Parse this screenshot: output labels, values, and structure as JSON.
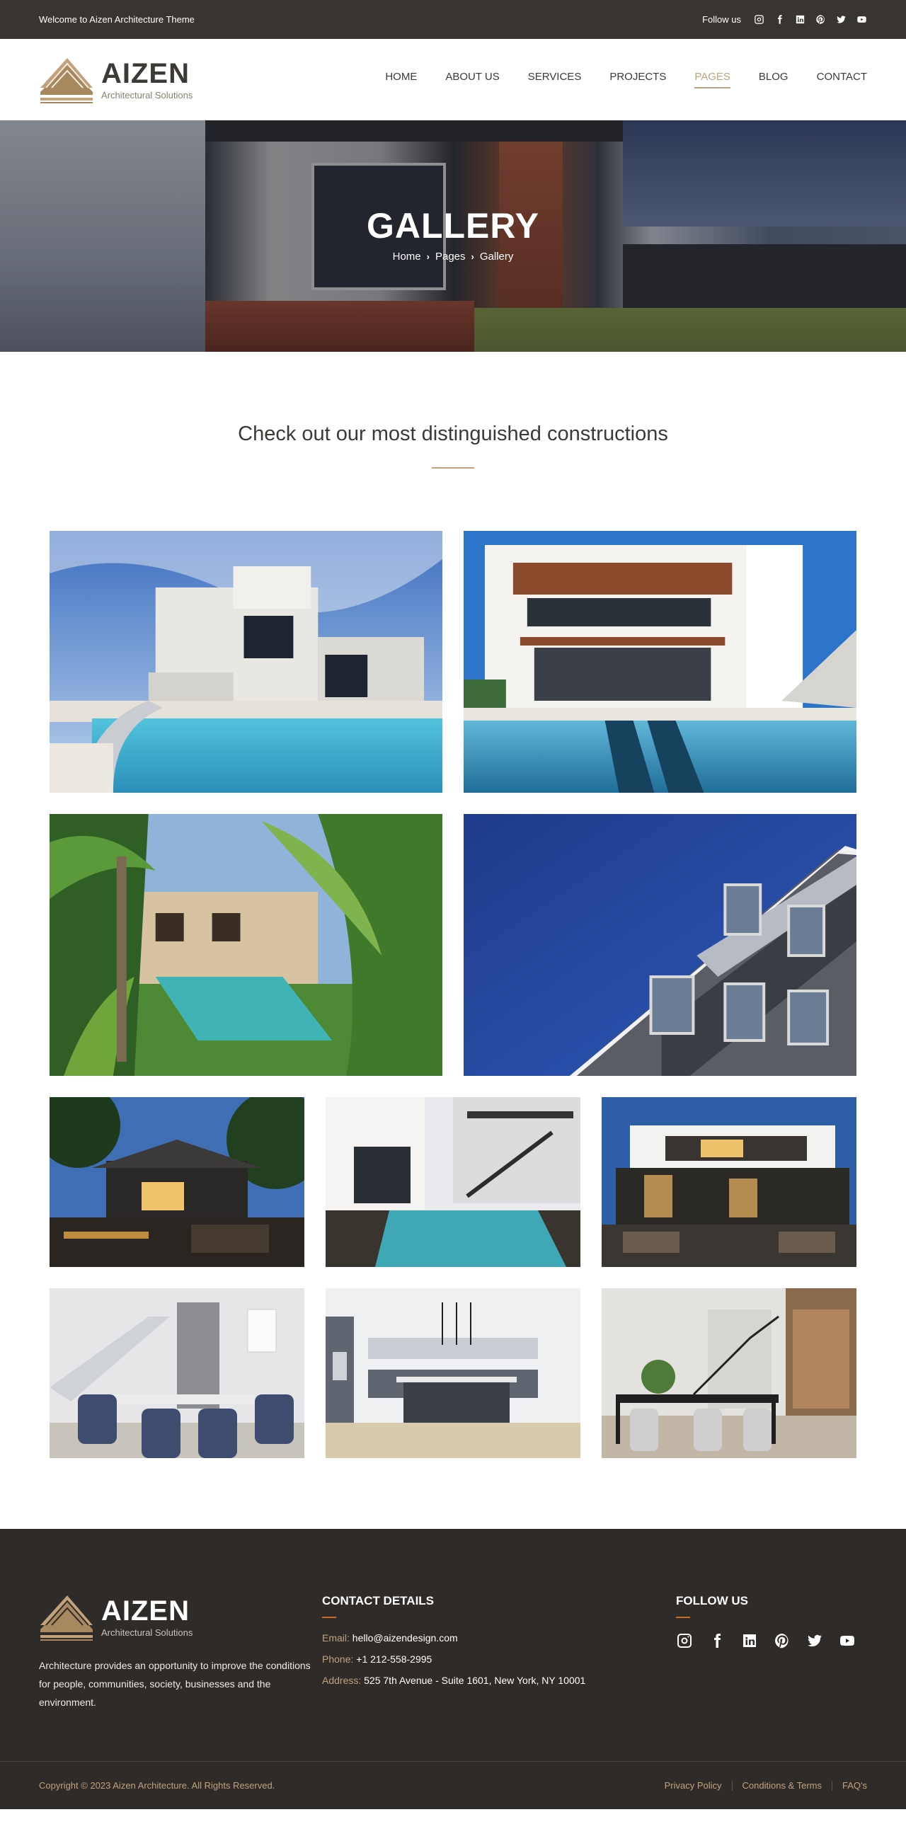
{
  "topbar": {
    "welcome": "Welcome to Aizen Architecture Theme",
    "follow_label": "Follow us",
    "social_icons": [
      "instagram-icon",
      "facebook-icon",
      "linkedin-icon",
      "pinterest-icon",
      "twitter-icon",
      "youtube-icon"
    ]
  },
  "brand": {
    "name": "AIZEN",
    "tagline": "Architectural Solutions",
    "accent_color": "#c2a27c"
  },
  "nav": {
    "items": [
      "HOME",
      "ABOUT US",
      "SERVICES",
      "PROJECTS",
      "PAGES",
      "BLOG",
      "CONTACT"
    ],
    "active": "PAGES"
  },
  "hero": {
    "title": "GALLERY",
    "breadcrumb": [
      "Home",
      "Pages",
      "Gallery"
    ]
  },
  "intro": {
    "heading": "Check out our most distinguished constructions"
  },
  "gallery": {
    "images": [
      "modern-villa-with-curved-pool",
      "white-modern-house-with-pool",
      "tropical-garden-pool",
      "modern-building-facade-sky",
      "house-at-dusk-outdoor-lounge",
      "courtyard-pool-with-staircase",
      "modern-house-night-lighting",
      "dining-room-with-staircase",
      "modern-kitchen-interior",
      "dining-area-with-glass-walls"
    ]
  },
  "footer": {
    "description": "Architecture provides an opportunity to improve the conditions for people, communities, society, businesses and the environment.",
    "contact": {
      "heading": "CONTACT DETAILS",
      "email_label": "Email: ",
      "email": "hello@aizendesign.com",
      "phone_label": "Phone: ",
      "phone": "+1 212-558-2995",
      "address_label": "Address: ",
      "address": "525 7th Avenue - Suite 1601, New York, NY 10001"
    },
    "follow": {
      "heading": "FOLLOW US"
    },
    "copyright": "Copyright © 2023 Aizen Architecture. All Rights Reserved.",
    "links": [
      "Privacy Policy",
      "Conditions & Terms",
      "FAQ's"
    ]
  },
  "colors": {
    "topbar_bg": "#38342f",
    "footer_bg": "#2e2b28",
    "divider": "#c2a27c",
    "footer_line": "#c86a2b"
  }
}
